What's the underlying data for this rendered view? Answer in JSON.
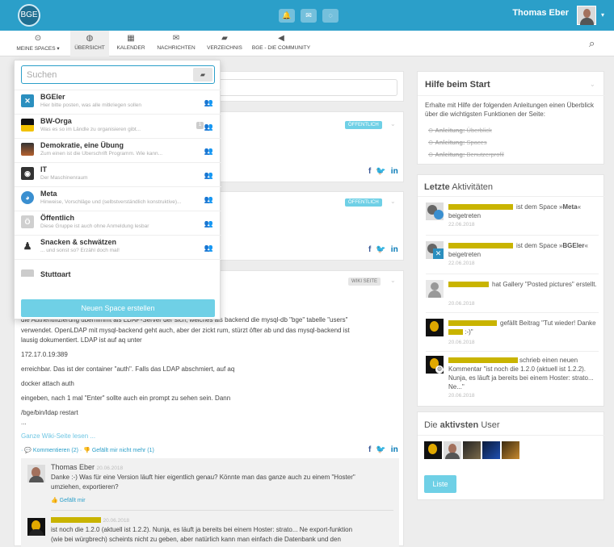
{
  "topbar": {
    "logo": "BGE",
    "username": "Thomas Eber"
  },
  "nav": {
    "items": [
      {
        "label": "MEINE SPACES ▾",
        "icon": "⊙"
      },
      {
        "label": "ÜBERSICHT",
        "icon": "◍"
      },
      {
        "label": "KALENDER",
        "icon": "▦"
      },
      {
        "label": "NACHRICHTEN",
        "icon": "✉"
      },
      {
        "label": "VERZEICHNIS",
        "icon": "▰"
      },
      {
        "label": "BGE - DIE COMMUNITY",
        "icon": "◀"
      }
    ]
  },
  "dropdown": {
    "search_placeholder": "Suchen",
    "spaces": [
      {
        "title": "BGEler",
        "desc": "Hier bitte posten, was alle mitkriegen sollen",
        "color": "#2b8fbf",
        "glyph": "✕"
      },
      {
        "title": "BW-Orga",
        "desc": "Was es so im Ländle zu organisieren gibt...",
        "color": "#222",
        "glyph": "",
        "badge": "1"
      },
      {
        "title": "Demokratie, eine Übung",
        "desc": "Zum einen ist die Überschrift Programm. Wie kann...",
        "color": "#8a4b2b",
        "glyph": ""
      },
      {
        "title": "IT",
        "desc": "Der Maschinenraum",
        "color": "#333",
        "glyph": "◉"
      },
      {
        "title": "Meta",
        "desc": "Hinweise, Vorschläge und (selbstverständlich konstruktive)...",
        "color": "#3a8fd0",
        "glyph": "◕"
      },
      {
        "title": "Öffentlich",
        "desc": "Diese Gruppe ist auch ohne Anmeldung lesbar",
        "color": "#cfcfcf",
        "glyph": "Ö"
      },
      {
        "title": "Snacken & schwätzen",
        "desc": "... und sonst so? Erzähl doch mal!",
        "color": "#444",
        "glyph": "♟"
      },
      {
        "title": "Stuttgart",
        "desc": "",
        "color": "#ccc",
        "glyph": ""
      }
    ],
    "new_space": "Neuen Space erstellen"
  },
  "posts": {
    "pill_public": "ÖFFENTLICH",
    "pill_wiki": "WIKI SEITE",
    "wiki_lines": [
      "die Authentifizierung ubernimmt als LDAP-Server der sich, welches als backend die mysql-db \"bge\" tabelle \"users\"",
      "verwendet. OpenLDAP mit mysql-backend geht auch, aber der zickt rum, stürzt öfter ab und das mysql-backend ist",
      "lausig dokumentiert. LDAP ist auf aq unter",
      "172.17.0.19:389",
      "erreichbar. Das ist der container \"auth\". Falls das LDAP abschmiert, auf aq",
      "docker attach auth",
      "eingeben, nach 1 mal \"Enter\" sollte auch ein prompt zu sehen sein. Dann",
      "/bge/bin/ldap restart",
      "..."
    ],
    "read_more": "Ganze Wiki-Seite lesen ...",
    "actions": "· 💬 Kommentieren (2) · 👎 Gefällt mir nicht mehr (1)",
    "comment1": {
      "author": "Thomas Eber",
      "date": "20.06.2018",
      "text1": "Danke :-) Was für eine Version läuft hier eigentlich genau? Könnte man das ganze auch zu einem \"Hoster\"",
      "text2": "umziehen, exportieren?",
      "like": "👍 Gefällt mir"
    },
    "comment2": {
      "date": "20.06.2018",
      "text1": "ist noch die 1.2.0 (aktuell ist 1.2.2). Nunja, es läuft ja bereits bei einem Hoster: strato... Ne export-funktion",
      "text2": "(wie bei würgbrech) scheints nicht zu geben, aber natürlich kann man einfach die Datenbank und den"
    }
  },
  "help": {
    "title": "Hilfe beim Start",
    "text": "Erhalte mit Hilfe der folgenden Anleitungen einen Überblick über die wichtigsten Funktionen der Seite:",
    "links": [
      {
        "bold": "Anleitung:",
        "rest": "Überblick"
      },
      {
        "bold": "Anleitung:",
        "rest": "Spaces"
      },
      {
        "bold": "Anleitung:",
        "rest": "Benutzerprofil"
      }
    ]
  },
  "activities": {
    "title_bold": "Letzte",
    "title_rest": "Aktivitäten",
    "items": [
      {
        "text": "ist dem Space »",
        "bold": "Meta",
        "after": "« beigetreten",
        "date": "22.06.2018"
      },
      {
        "text": "ist dem Space »",
        "bold": "BGEler",
        "after": "« beigetreten",
        "date": "22.06.2018"
      },
      {
        "text": "hat Gallery \"Posted pictures\" erstellt.",
        "bold": "",
        "after": "",
        "date": "20.06.2018"
      },
      {
        "text": "gefällt Beitrag \"Tut wieder! Danke",
        "bold": "",
        "after": ":-)\"",
        "date": "20.06.2018"
      },
      {
        "text": "schrieb einen neuen Kommentar \"ist noch die 1.2.0 (aktuell ist 1.2.2). Nunja, es läuft ja bereits bei einem Hoster: strato... Ne...\"",
        "bold": "",
        "after": "",
        "date": "20.06.2018"
      }
    ]
  },
  "active_users": {
    "title_pre": "Die",
    "title_bold": "aktivsten",
    "title_post": "User",
    "button": "Liste"
  }
}
